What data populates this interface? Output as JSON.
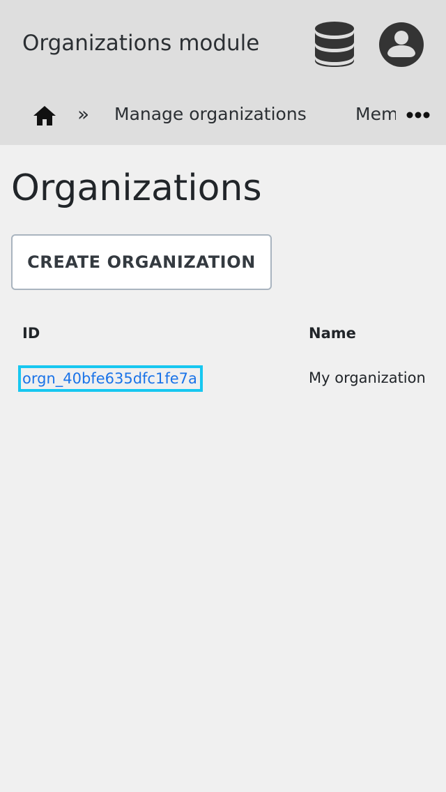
{
  "header": {
    "app_title": "Organizations module"
  },
  "breadcrumb": {
    "separator": "»",
    "items": [
      "Manage organizations",
      "Mem"
    ]
  },
  "main": {
    "title": "Organizations",
    "create_button": "CREATE ORGANIZATION",
    "table": {
      "columns": [
        "ID",
        "Name"
      ],
      "rows": [
        {
          "id": "orgn_40bfe635dfc1fe7a",
          "name": "My organization"
        }
      ]
    }
  },
  "icons": {
    "database": "database-icon",
    "user": "user-account-icon",
    "home": "home-icon",
    "more": "more-horizontal-icon"
  },
  "colors": {
    "header_bg": "#dedede",
    "page_bg": "#f0f0f0",
    "link": "#1a73e8",
    "focus_ring": "#17c7f0",
    "icon": "#343434"
  }
}
